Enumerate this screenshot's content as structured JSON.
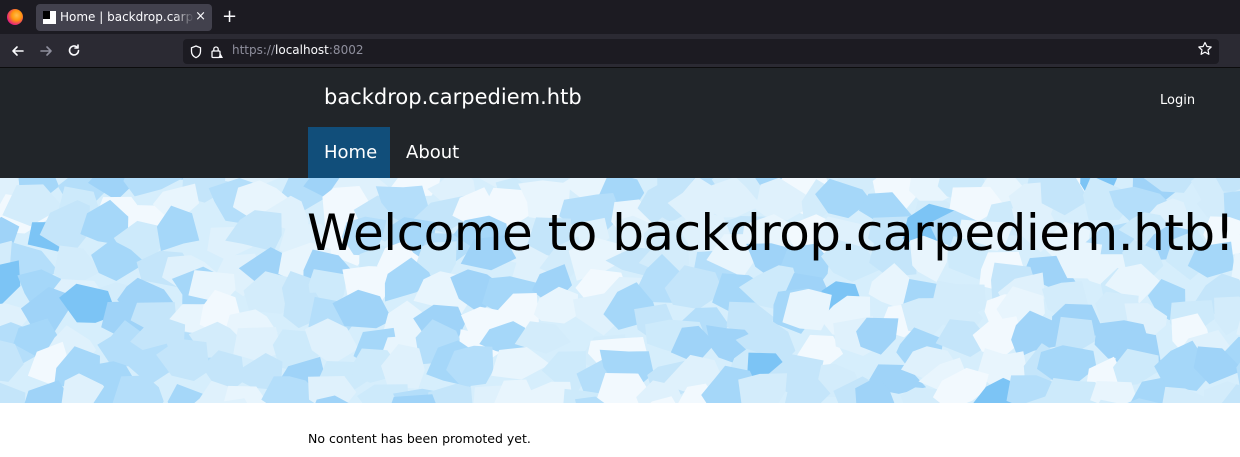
{
  "browser": {
    "tab_title": "Home | backdrop.carpediem.htb",
    "tab_close": "×",
    "new_tab": "+",
    "url_prefix": "https://",
    "url_host": "localhost",
    "url_port": ":8002",
    "icons": [
      "firefox-logo",
      "back-arrow",
      "forward-arrow",
      "reload",
      "shield",
      "lock",
      "star"
    ]
  },
  "site": {
    "name": "backdrop.carpediem.htb",
    "login": "Login",
    "menu": [
      {
        "label": "Home",
        "active": true
      },
      {
        "label": "About",
        "active": false
      }
    ],
    "hero_title": "Welcome to backdrop.carpediem.htb!",
    "promoted_text": "No content has been promoted yet."
  },
  "colors": {
    "header_bg": "#212529",
    "active_menu_bg": "#114e7a",
    "hero_bg": "#d6eefc"
  }
}
